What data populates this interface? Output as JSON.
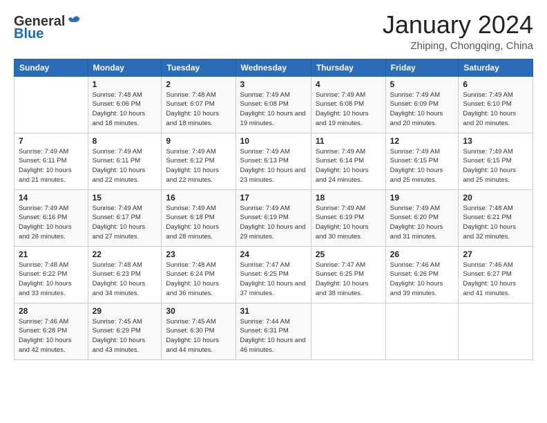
{
  "header": {
    "logo_general": "General",
    "logo_blue": "Blue",
    "month_title": "January 2024",
    "subtitle": "Zhiping, Chongqing, China"
  },
  "days_of_week": [
    "Sunday",
    "Monday",
    "Tuesday",
    "Wednesday",
    "Thursday",
    "Friday",
    "Saturday"
  ],
  "weeks": [
    [
      {
        "day": "",
        "sunrise": "",
        "sunset": "",
        "daylight": ""
      },
      {
        "day": "1",
        "sunrise": "Sunrise: 7:48 AM",
        "sunset": "Sunset: 6:06 PM",
        "daylight": "Daylight: 10 hours and 18 minutes."
      },
      {
        "day": "2",
        "sunrise": "Sunrise: 7:48 AM",
        "sunset": "Sunset: 6:07 PM",
        "daylight": "Daylight: 10 hours and 18 minutes."
      },
      {
        "day": "3",
        "sunrise": "Sunrise: 7:49 AM",
        "sunset": "Sunset: 6:08 PM",
        "daylight": "Daylight: 10 hours and 19 minutes."
      },
      {
        "day": "4",
        "sunrise": "Sunrise: 7:49 AM",
        "sunset": "Sunset: 6:08 PM",
        "daylight": "Daylight: 10 hours and 19 minutes."
      },
      {
        "day": "5",
        "sunrise": "Sunrise: 7:49 AM",
        "sunset": "Sunset: 6:09 PM",
        "daylight": "Daylight: 10 hours and 20 minutes."
      },
      {
        "day": "6",
        "sunrise": "Sunrise: 7:49 AM",
        "sunset": "Sunset: 6:10 PM",
        "daylight": "Daylight: 10 hours and 20 minutes."
      }
    ],
    [
      {
        "day": "7",
        "sunrise": "Sunrise: 7:49 AM",
        "sunset": "Sunset: 6:11 PM",
        "daylight": "Daylight: 10 hours and 21 minutes."
      },
      {
        "day": "8",
        "sunrise": "Sunrise: 7:49 AM",
        "sunset": "Sunset: 6:11 PM",
        "daylight": "Daylight: 10 hours and 22 minutes."
      },
      {
        "day": "9",
        "sunrise": "Sunrise: 7:49 AM",
        "sunset": "Sunset: 6:12 PM",
        "daylight": "Daylight: 10 hours and 22 minutes."
      },
      {
        "day": "10",
        "sunrise": "Sunrise: 7:49 AM",
        "sunset": "Sunset: 6:13 PM",
        "daylight": "Daylight: 10 hours and 23 minutes."
      },
      {
        "day": "11",
        "sunrise": "Sunrise: 7:49 AM",
        "sunset": "Sunset: 6:14 PM",
        "daylight": "Daylight: 10 hours and 24 minutes."
      },
      {
        "day": "12",
        "sunrise": "Sunrise: 7:49 AM",
        "sunset": "Sunset: 6:15 PM",
        "daylight": "Daylight: 10 hours and 25 minutes."
      },
      {
        "day": "13",
        "sunrise": "Sunrise: 7:49 AM",
        "sunset": "Sunset: 6:15 PM",
        "daylight": "Daylight: 10 hours and 25 minutes."
      }
    ],
    [
      {
        "day": "14",
        "sunrise": "Sunrise: 7:49 AM",
        "sunset": "Sunset: 6:16 PM",
        "daylight": "Daylight: 10 hours and 26 minutes."
      },
      {
        "day": "15",
        "sunrise": "Sunrise: 7:49 AM",
        "sunset": "Sunset: 6:17 PM",
        "daylight": "Daylight: 10 hours and 27 minutes."
      },
      {
        "day": "16",
        "sunrise": "Sunrise: 7:49 AM",
        "sunset": "Sunset: 6:18 PM",
        "daylight": "Daylight: 10 hours and 28 minutes."
      },
      {
        "day": "17",
        "sunrise": "Sunrise: 7:49 AM",
        "sunset": "Sunset: 6:19 PM",
        "daylight": "Daylight: 10 hours and 29 minutes."
      },
      {
        "day": "18",
        "sunrise": "Sunrise: 7:49 AM",
        "sunset": "Sunset: 6:19 PM",
        "daylight": "Daylight: 10 hours and 30 minutes."
      },
      {
        "day": "19",
        "sunrise": "Sunrise: 7:49 AM",
        "sunset": "Sunset: 6:20 PM",
        "daylight": "Daylight: 10 hours and 31 minutes."
      },
      {
        "day": "20",
        "sunrise": "Sunrise: 7:48 AM",
        "sunset": "Sunset: 6:21 PM",
        "daylight": "Daylight: 10 hours and 32 minutes."
      }
    ],
    [
      {
        "day": "21",
        "sunrise": "Sunrise: 7:48 AM",
        "sunset": "Sunset: 6:22 PM",
        "daylight": "Daylight: 10 hours and 33 minutes."
      },
      {
        "day": "22",
        "sunrise": "Sunrise: 7:48 AM",
        "sunset": "Sunset: 6:23 PM",
        "daylight": "Daylight: 10 hours and 34 minutes."
      },
      {
        "day": "23",
        "sunrise": "Sunrise: 7:48 AM",
        "sunset": "Sunset: 6:24 PM",
        "daylight": "Daylight: 10 hours and 36 minutes."
      },
      {
        "day": "24",
        "sunrise": "Sunrise: 7:47 AM",
        "sunset": "Sunset: 6:25 PM",
        "daylight": "Daylight: 10 hours and 37 minutes."
      },
      {
        "day": "25",
        "sunrise": "Sunrise: 7:47 AM",
        "sunset": "Sunset: 6:25 PM",
        "daylight": "Daylight: 10 hours and 38 minutes."
      },
      {
        "day": "26",
        "sunrise": "Sunrise: 7:46 AM",
        "sunset": "Sunset: 6:26 PM",
        "daylight": "Daylight: 10 hours and 39 minutes."
      },
      {
        "day": "27",
        "sunrise": "Sunrise: 7:46 AM",
        "sunset": "Sunset: 6:27 PM",
        "daylight": "Daylight: 10 hours and 41 minutes."
      }
    ],
    [
      {
        "day": "28",
        "sunrise": "Sunrise: 7:46 AM",
        "sunset": "Sunset: 6:28 PM",
        "daylight": "Daylight: 10 hours and 42 minutes."
      },
      {
        "day": "29",
        "sunrise": "Sunrise: 7:45 AM",
        "sunset": "Sunset: 6:29 PM",
        "daylight": "Daylight: 10 hours and 43 minutes."
      },
      {
        "day": "30",
        "sunrise": "Sunrise: 7:45 AM",
        "sunset": "Sunset: 6:30 PM",
        "daylight": "Daylight: 10 hours and 44 minutes."
      },
      {
        "day": "31",
        "sunrise": "Sunrise: 7:44 AM",
        "sunset": "Sunset: 6:31 PM",
        "daylight": "Daylight: 10 hours and 46 minutes."
      },
      {
        "day": "",
        "sunrise": "",
        "sunset": "",
        "daylight": ""
      },
      {
        "day": "",
        "sunrise": "",
        "sunset": "",
        "daylight": ""
      },
      {
        "day": "",
        "sunrise": "",
        "sunset": "",
        "daylight": ""
      }
    ]
  ]
}
